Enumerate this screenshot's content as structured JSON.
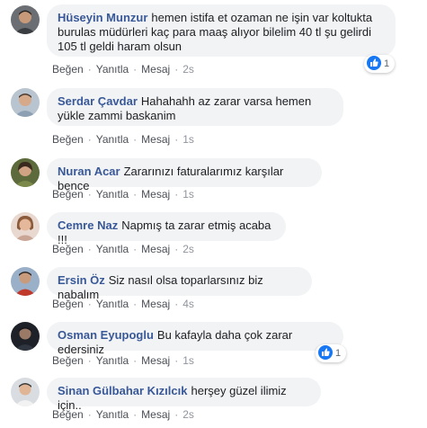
{
  "comments": [
    {
      "name": "Hüseyin Munzur",
      "text": "hemen istifa et ozaman ne işin var koltukta burulas müdürleri kaç para maaş alıyor bilelim 40 tl şu gelirdi 105 tl geldi haram olsun",
      "like": "Beğen",
      "reply": "Yanıtla",
      "message": "Mesaj",
      "time": "2s",
      "reaction_count": "1",
      "avatar_colors": {
        "bg": "#6b6e73",
        "skin": "#c89a7a",
        "hair": "#2b2622",
        "shirt": "#3a3d42"
      }
    },
    {
      "name": "Serdar Çavdar",
      "text": "Hahahahh az zarar varsa hemen yükle zammi baskanim",
      "like": "Beğen",
      "reply": "Yanıtla",
      "message": "Mesaj",
      "time": "1s",
      "avatar_colors": {
        "bg": "#b8c4cf",
        "skin": "#d5a98a",
        "hair": "#4a3a30",
        "shirt": "#8da0b3"
      }
    },
    {
      "name": "Nuran Acar",
      "text": "Zararınızı faturalarımız karşılar bence",
      "like": "Beğen",
      "reply": "Yanıtla",
      "message": "Mesaj",
      "time": "1s",
      "avatar_colors": {
        "bg": "#5d6b3c",
        "skin": "#d0a384",
        "hair": "#3a2a1e",
        "shirt": "#7b8a4a"
      }
    },
    {
      "name": "Cemre Naz",
      "text": "Napmış ta zarar etmiş acaba !!!",
      "like": "Beğen",
      "reply": "Yanıtla",
      "message": "Mesaj",
      "time": "2s",
      "avatar_colors": {
        "bg": "#e8d8cf",
        "skin": "#e6b89b",
        "hair": "#8a5a3a",
        "shirt": "#c9a596"
      }
    },
    {
      "name": "Ersin Öz",
      "text": "Siz nasıl olsa toparlarsınız biz nabalım",
      "like": "Beğen",
      "reply": "Yanıtla",
      "message": "Mesaj",
      "time": "4s",
      "avatar_colors": {
        "bg": "#9ab0c8",
        "skin": "#c99b7d",
        "hair": "#2e2a28",
        "shirt": "#c0392b"
      }
    },
    {
      "name": "Osman Eyupoglu",
      "text": "Bu kafayla daha çok zarar edersiniz",
      "like": "Beğen",
      "reply": "Yanıtla",
      "message": "Mesaj",
      "time": "1s",
      "reaction_count": "1",
      "avatar_colors": {
        "bg": "#1e2228",
        "skin": "#9a7a66",
        "hair": "#14161a",
        "shirt": "#2f3640"
      }
    },
    {
      "name": "Sinan Gülbahar Kızılcık",
      "text": "herşey güzel ilimiz için..",
      "like": "Beğen",
      "reply": "Yanıtla",
      "message": "Mesaj",
      "time": "2s",
      "avatar_colors": {
        "bg": "#d9dde2",
        "skin": "#e0b596",
        "hair": "#3b3b3b",
        "shirt": "#f2f2f2"
      }
    }
  ],
  "like_icon": "thumbs-up-icon",
  "accent_color": "#1877f2"
}
